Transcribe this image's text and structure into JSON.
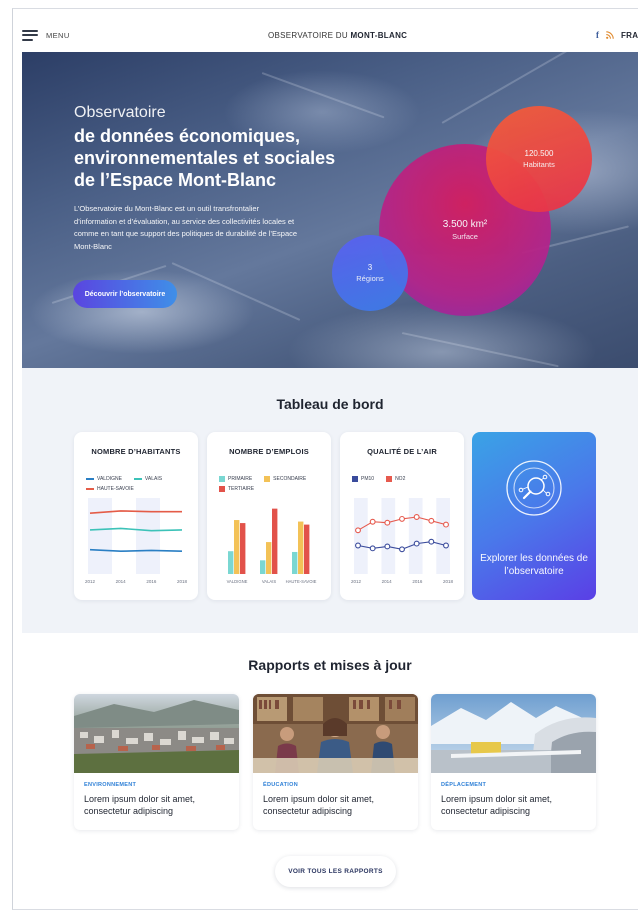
{
  "header": {
    "menu_label": "MENU",
    "title_prefix": "OBSERVATOIRE DU ",
    "title_strong": "MONT-BLANC",
    "facebook": "f",
    "language": "FRA"
  },
  "hero": {
    "kicker": "Observatoire",
    "heading": "de données économiques, environnementales et sociales de l’Espace Mont-Blanc",
    "description": "L’Observatoire du Mont-Blanc est un outil transfrontalier d’information et d’évaluation, au service des collectivités locales et comme en tant que support des politiques de durabilité de l’Espace Mont-Blanc",
    "cta": "Découvrir l’observatoire",
    "stats": {
      "surface": {
        "value": "3.500 km²",
        "label": "Surface"
      },
      "habitants": {
        "value": "120.500",
        "label": "Habitants"
      },
      "regions": {
        "value": "3",
        "label": "Régions"
      }
    }
  },
  "dashboard": {
    "title": "Tableau de bord",
    "cards": [
      {
        "title": "NOMBRE D’HABITANTS"
      },
      {
        "title": "NOMBRE D’EMPLOIS"
      },
      {
        "title": "QUALITÉ DE L’AIR"
      }
    ],
    "explore_label": "Explorer les données de l’observatoire"
  },
  "chart_data": [
    {
      "type": "line",
      "title": "NOMBRE D’HABITANTS",
      "x": [
        "2012",
        "2014",
        "2016",
        "2018"
      ],
      "series": [
        {
          "name": "VALDIGNE",
          "color": "#2a7fc4",
          "values": [
            32,
            30,
            31,
            30
          ]
        },
        {
          "name": "VALAIS",
          "color": "#3cc2b8",
          "values": [
            58,
            60,
            57,
            58
          ]
        },
        {
          "name": "HAUTE-SAVOIE",
          "color": "#e45c48",
          "values": [
            80,
            83,
            82,
            82
          ]
        }
      ],
      "ylim": [
        0,
        100
      ]
    },
    {
      "type": "bar",
      "title": "NOMBRE D’EMPLOIS",
      "categories": [
        "VALDIGNE",
        "VALAIS",
        "HAUTE-SAVOIE"
      ],
      "series": [
        {
          "name": "PRIMAIRE",
          "color": "#7ad7d2",
          "values": [
            30,
            18,
            29
          ]
        },
        {
          "name": "SECONDAIRE",
          "color": "#f3c257",
          "values": [
            71,
            42,
            69
          ]
        },
        {
          "name": "TERTIAIRE",
          "color": "#e2524a",
          "values": [
            67,
            86,
            65
          ]
        }
      ],
      "ylim": [
        0,
        100
      ]
    },
    {
      "type": "line",
      "title": "QUALITÉ DE L’AIR",
      "x": [
        "2012",
        "2014",
        "2016",
        "2018"
      ],
      "series": [
        {
          "name": "PM10",
          "color": "#3a4b9c",
          "values": [
            30,
            27,
            29,
            26,
            32,
            34,
            30
          ]
        },
        {
          "name": "NO2",
          "color": "#e65a4e",
          "values": [
            46,
            55,
            54,
            58,
            60,
            56,
            52
          ]
        }
      ],
      "ylim": [
        0,
        80
      ]
    }
  ],
  "reports": {
    "title": "Rapports et mises à jour",
    "items": [
      {
        "category": "ENVIRONNEMENT",
        "text": "Lorem ipsum dolor sit amet, consectetur adipiscing"
      },
      {
        "category": "ÉDUCATION",
        "text": "Lorem ipsum dolor sit amet, consectetur adipiscing"
      },
      {
        "category": "DÉPLACEMENT",
        "text": "Lorem ipsum dolor sit amet, consectetur adipiscing"
      }
    ],
    "see_all": "VOIR TOUS LES RAPPORTS"
  }
}
